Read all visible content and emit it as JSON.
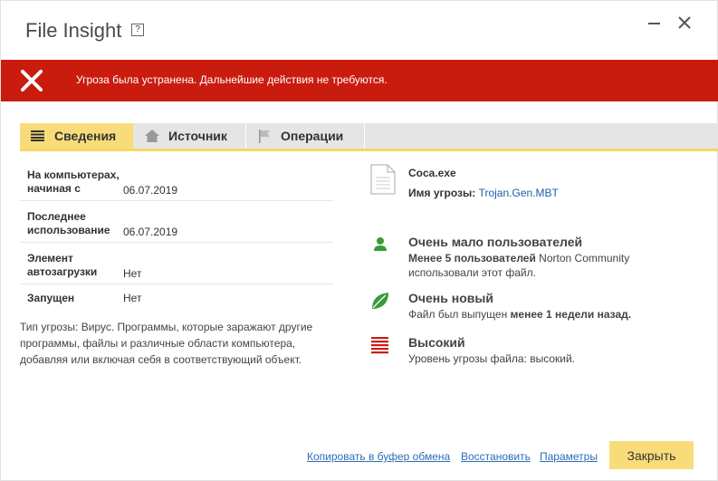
{
  "window": {
    "title": "File Insight",
    "help_label": "?"
  },
  "alert": {
    "text": "Угроза была устранена. Дальнейшие действия не требуются.",
    "color": "#c91c0f"
  },
  "tabs": [
    {
      "label": "Сведения",
      "icon": "list-icon",
      "active": true
    },
    {
      "label": "Источник",
      "icon": "home-icon",
      "active": false
    },
    {
      "label": "Операции",
      "icon": "flag-icon",
      "active": false
    }
  ],
  "info": [
    {
      "label": "На компьютерах, начиная с",
      "value": "06.07.2019"
    },
    {
      "label": "Последнее использование",
      "value": "06.07.2019"
    },
    {
      "label": "Элемент автозагрузки",
      "value": "Нет"
    },
    {
      "label": "Запущен",
      "value": "Нет"
    }
  ],
  "threat_description": "Тип угрозы: Вирус. Программы, которые заражают другие программы, файлы и различные области компьютера, добавляя или включая себя в соответствующий объект.",
  "file": {
    "name": "Coca.exe",
    "threat_label": "Имя угрозы:",
    "threat_name": "Trojan.Gen.MBT",
    "icon": "document-icon"
  },
  "stats": [
    {
      "icon": "user-icon",
      "title": "Очень мало пользователей",
      "desc_bold": "Менее 5 пользователей",
      "desc_rest": " Norton Community использовали этот файл."
    },
    {
      "icon": "leaf-icon",
      "title": "Очень новый",
      "desc_pre": "Файл был выпущен ",
      "desc_bold": "менее 1 недели назад."
    },
    {
      "icon": "threat-level-icon",
      "title": "Высокий",
      "desc": "Уровень угрозы файла: высокий."
    }
  ],
  "footer": {
    "copy_link": "Копировать в буфер обмена",
    "restore_link": "Восстановить",
    "params_link": "Параметры",
    "close_button": "Закрыть"
  },
  "colors": {
    "accent": "#f9dc7a",
    "link": "#2d6db5",
    "green": "#3a9a3a"
  }
}
